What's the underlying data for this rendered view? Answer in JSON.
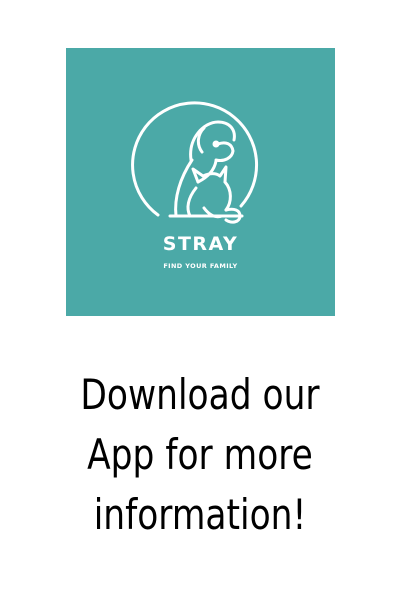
{
  "logo": {
    "name": "STRAY",
    "tagline": "FIND YOUR FAMILY",
    "background_color": "#4ba9a7",
    "icon": "dog-and-cat-icon"
  },
  "cta": {
    "lines": [
      "Download our",
      "App for more",
      "information!"
    ]
  }
}
